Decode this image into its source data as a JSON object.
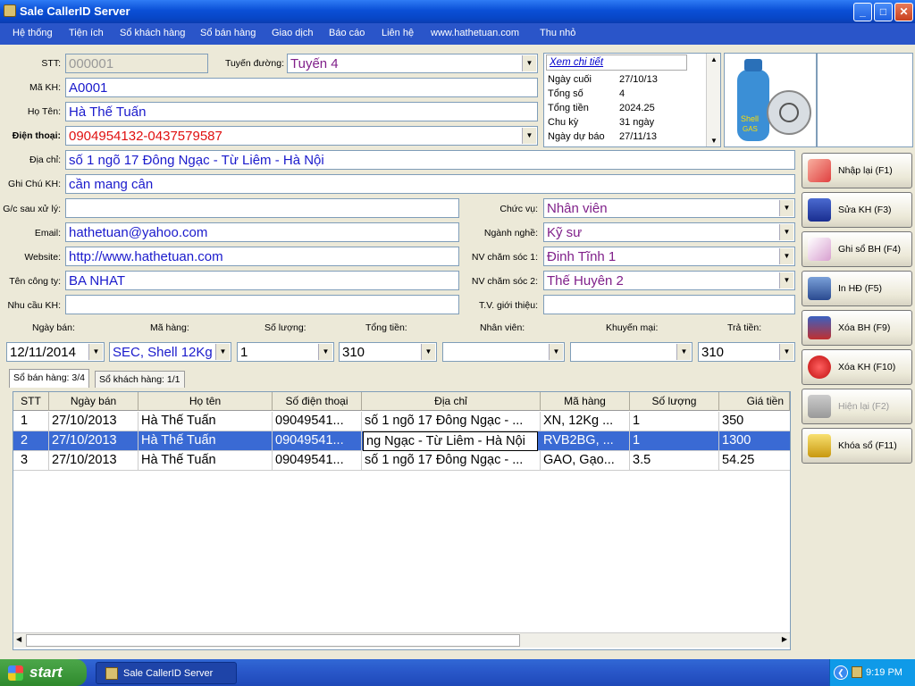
{
  "window": {
    "title": "Sale CallerID Server",
    "min": "_",
    "max": "□",
    "close": "✕"
  },
  "menu": [
    "Hệ thống",
    "Tiện ích",
    "Sổ khách hàng",
    "Sổ bán hàng",
    "Giao dịch",
    "Báo cáo",
    "Liên hệ",
    "www.hathetuan.com",
    "Thu nhỏ"
  ],
  "form": {
    "stt_label": "STT:",
    "stt_value": "000001",
    "route_label": "Tuyến đường:",
    "route_value": "Tuyến 4",
    "makh_label": "Mã KH:",
    "makh_value": "A0001",
    "name_label": "Họ Tên:",
    "name_value": "Hà Thế Tuấn",
    "phone_label": "Điện thoại:",
    "phone_value": "0904954132-0437579587",
    "address_label": "Địa chỉ:",
    "address_value": "số 1 ngõ 17 Đông Ngạc - Từ Liêm - Hà Nội",
    "note_label": "Ghi Chú KH:",
    "note_value": "cần mang cân",
    "gc_label": "G/c sau xử lý:",
    "gc_value": "",
    "email_label": "Email:",
    "email_value": "hathetuan@yahoo.com",
    "website_label": "Website:",
    "website_value": "http://www.hathetuan.com",
    "company_label": "Tên công ty:",
    "company_value": "BA NHAT",
    "needs_label": "Nhu cầu KH:",
    "needs_value": "",
    "position_label": "Chức vụ:",
    "position_value": "Nhân viên",
    "job_label": "Ngành nghề:",
    "job_value": "Kỹ sư",
    "nv1_label": "NV chăm sóc 1:",
    "nv1_value": "Đinh Tĩnh 1",
    "nv2_label": "NV chăm sóc 2:",
    "nv2_value": "Thế Huyên 2",
    "tv_label": "T.V. giới thiệu:",
    "tv_value": ""
  },
  "info": {
    "link": "Xem chi tiết",
    "rows": [
      {
        "label": "Ngày cuối",
        "value": "27/10/13"
      },
      {
        "label": "Tổng số",
        "value": "4"
      },
      {
        "label": "Tổng tiền",
        "value": "2024.25"
      },
      {
        "label": "Chu kỳ",
        "value": "31 ngày"
      },
      {
        "label": "Ngày dự báo",
        "value": "27/11/13"
      }
    ]
  },
  "buttons": [
    "Nhập lại (F1)",
    "Sửa KH (F3)",
    "Ghi sổ BH (F4)",
    "In HĐ (F5)",
    "Xóa BH (F9)",
    "Xóa KH (F10)",
    "Hiện lại (F2)",
    "Khóa sổ (F11)"
  ],
  "sale": {
    "headers": [
      "Ngày bán:",
      "Mã hàng:",
      "Số lượng:",
      "Tổng tiền:",
      "Nhân viên:",
      "Khuyến mại:",
      "Trả tiền:"
    ],
    "values": [
      "12/11/2014",
      "SEC, Shell 12Kg",
      "1",
      "310",
      "",
      "",
      "310"
    ]
  },
  "tabs": [
    "Sổ bán hàng: 3/4",
    "Sổ khách hàng: 1/1"
  ],
  "grid": {
    "columns": [
      "STT",
      "Ngày bán",
      "Họ tên",
      "Số điện thoại",
      "Địa chỉ",
      "Mã hàng",
      "Số lượng",
      "Giá tiền"
    ],
    "rows": [
      [
        "1",
        "27/10/2013",
        "Hà Thế Tuấn",
        "09049541...",
        "số 1 ngõ 17 Đông Ngạc - ...",
        "XN, 12Kg ...",
        "1",
        "350"
      ],
      [
        "2",
        "27/10/2013",
        "Hà Thế Tuấn",
        "09049541...",
        "ng Ngạc - Từ Liêm - Hà Nội",
        "RVB2BG, ...",
        "1",
        "1300"
      ],
      [
        "3",
        "27/10/2013",
        "Hà Thế Tuấn",
        "09049541...",
        "số 1 ngõ 17 Đông Ngạc - ...",
        "GAO, Gạo...",
        "3.5",
        "54.25"
      ]
    ]
  },
  "taskbar": {
    "start": "start",
    "item": "Sale CallerID Server",
    "time": "9:19 PM"
  },
  "photo_text": {
    "brand": "Shell",
    "sub": "GAS"
  }
}
